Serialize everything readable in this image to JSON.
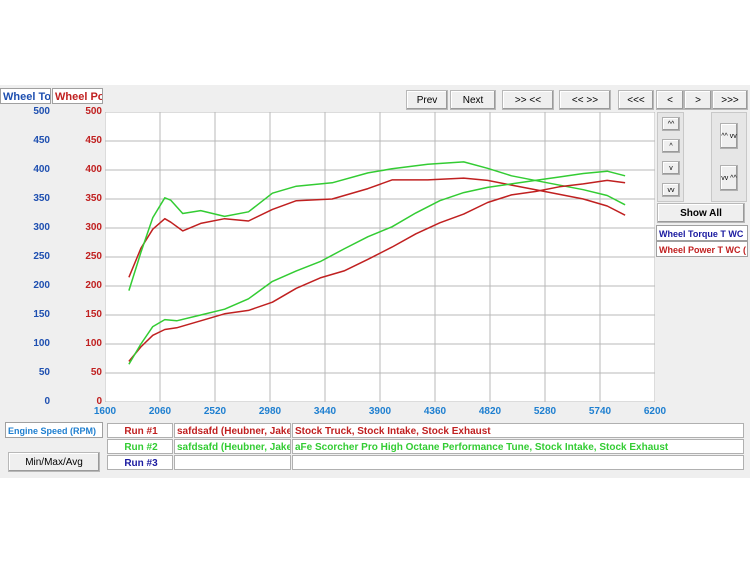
{
  "headers": {
    "left_axis": "Wheel Torc",
    "right_axis": "Wheel Pow"
  },
  "toolbar": {
    "prev": "Prev",
    "next": "Next",
    "zoom_in_x": ">> <<",
    "zoom_out_x": "<< >>",
    "far_left": "<<<",
    "left": "<",
    "right": ">",
    "far_right": ">>>"
  },
  "side": {
    "show_all": "Show All",
    "legend1": "Wheel Torque T WC",
    "legend2": "Wheel Power T WC (",
    "up_up": "^^",
    "up": "^",
    "down": "v",
    "down_down": "vv",
    "zoom_in_y": "^^ vv",
    "zoom_out_y": "vv ^^"
  },
  "bottom": {
    "x_axis_label": "Engine Speed (RPM)",
    "minmax": "Min/Max/Avg",
    "runs": [
      {
        "label": "Run #1",
        "name": "safdsafd (Heubner, Jake)",
        "desc": "Stock Truck, Stock Intake, Stock Exhaust"
      },
      {
        "label": "Run #2",
        "name": "safdsafd (Heubner, Jake)",
        "desc": "aFe Scorcher Pro High Octane Performance Tune, Stock Intake, Stock Exhaust"
      },
      {
        "label": "Run #3",
        "name": "",
        "desc": ""
      }
    ]
  },
  "colors": {
    "run1": "#c02020",
    "run2": "#33cc33",
    "run3": "#1a1aa0",
    "left_axis": "#1e4fb0",
    "grid": "#b8b8b8"
  },
  "chart_data": {
    "type": "line",
    "xlabel": "Engine Speed (RPM)",
    "ylabel_left": "Wheel Torc",
    "ylabel_right": "Wheel Pow",
    "xlim": [
      1600,
      6200
    ],
    "ylim": [
      0,
      500
    ],
    "x_ticks": [
      1600,
      2060,
      2520,
      2980,
      3440,
      3900,
      4360,
      4820,
      5280,
      5740,
      6200
    ],
    "y_ticks_left": [
      0,
      50,
      100,
      150,
      200,
      250,
      300,
      350,
      400,
      450,
      500
    ],
    "y_ticks_right": [
      0,
      50,
      100,
      150,
      200,
      250,
      300,
      350,
      400,
      450,
      500
    ],
    "grid": true,
    "series": [
      {
        "name": "Run #1",
        "color": "#c02020",
        "x": [
          1800,
          1900,
          2000,
          2100,
          2150,
          2250,
          2400,
          2600,
          2800,
          3000,
          3200,
          3500,
          3800,
          4000,
          4300,
          4600,
          4800,
          5000,
          5300,
          5600,
          5800,
          5950
        ],
        "y": [
          215,
          265,
          298,
          316,
          310,
          295,
          308,
          316,
          312,
          332,
          347,
          350,
          368,
          383,
          383,
          386,
          382,
          374,
          362,
          350,
          338,
          322
        ]
      },
      {
        "name": "Run #2",
        "color": "#33cc33",
        "x": [
          1800,
          1900,
          2000,
          2100,
          2150,
          2250,
          2400,
          2600,
          2800,
          3000,
          3200,
          3500,
          3800,
          4000,
          4300,
          4600,
          4800,
          5000,
          5300,
          5600,
          5800,
          5950
        ],
        "y": [
          192,
          258,
          318,
          352,
          348,
          325,
          330,
          320,
          328,
          360,
          372,
          378,
          395,
          402,
          410,
          414,
          403,
          390,
          378,
          366,
          356,
          340
        ]
      },
      {
        "name": "Run #1",
        "color": "#c02020",
        "x": [
          1800,
          1900,
          2000,
          2100,
          2200,
          2400,
          2600,
          2800,
          3000,
          3200,
          3400,
          3600,
          3800,
          4000,
          4200,
          4400,
          4600,
          4800,
          5000,
          5200,
          5400,
          5600,
          5800,
          5950
        ],
        "y": [
          70,
          95,
          115,
          125,
          128,
          140,
          152,
          158,
          172,
          196,
          214,
          226,
          246,
          267,
          290,
          309,
          324,
          344,
          357,
          363,
          371,
          376,
          382,
          378
        ]
      },
      {
        "name": "Run #2",
        "color": "#33cc33",
        "x": [
          1800,
          1900,
          2000,
          2100,
          2200,
          2400,
          2600,
          2800,
          3000,
          3200,
          3400,
          3600,
          3800,
          4000,
          4200,
          4400,
          4600,
          4800,
          5000,
          5200,
          5400,
          5600,
          5800,
          5950
        ],
        "y": [
          65,
          100,
          130,
          142,
          140,
          150,
          160,
          178,
          208,
          226,
          242,
          264,
          285,
          302,
          326,
          347,
          361,
          370,
          376,
          382,
          388,
          394,
          398,
          390
        ]
      }
    ]
  }
}
